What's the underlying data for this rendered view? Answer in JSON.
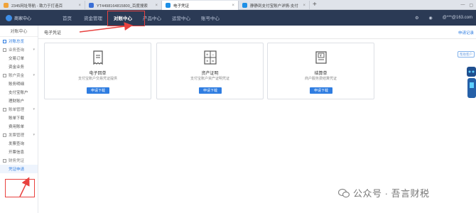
{
  "browser": {
    "tabs": [
      {
        "label": "2345网址导航 - 致力于打造百"
      },
      {
        "label": "YT4498164815800_百度搜索"
      },
      {
        "label": "电子凭证"
      },
      {
        "label": "静静到支付宝账户详情-支付"
      }
    ],
    "new_tab": "+"
  },
  "header": {
    "brand": "商家中心",
    "nav": [
      "首页",
      "资金管理",
      "对账中心",
      "产品中心",
      "运营中心",
      "账号中心"
    ],
    "user": "@***@163.com"
  },
  "sidebar": {
    "title": "对账中心",
    "overview": "对账总览",
    "groups": [
      {
        "label": "业务查询",
        "items": [
          "交易订单",
          "资金业务"
        ]
      },
      {
        "label": "账户资金",
        "items": [
          "账务明细",
          "支付宝账户",
          "理财账户"
        ]
      },
      {
        "label": "账单管理",
        "items": [
          "账单下载",
          "费用账单"
        ]
      },
      {
        "label": "发票管理",
        "items": [
          "发票查询",
          "开票信息"
        ]
      },
      {
        "label": "财务凭证",
        "items": [
          "凭证申请"
        ]
      }
    ]
  },
  "main": {
    "breadcrumb": "电子凭证",
    "right_link": "申请记录",
    "float_tag": "帮助客户",
    "cards": [
      {
        "title": "电子回单",
        "desc": "支付宝账户交易凭证提供",
        "button": "申请下载",
        "icon": "receipt-icon"
      },
      {
        "title": "资产证明",
        "desc": "支付宝账户资产证明凭证",
        "button": "申请下载",
        "icon": "calculator-icon"
      },
      {
        "title": "结算单",
        "desc": "商户服务费结算凭证",
        "button": "申请下载",
        "icon": "yen-document-icon"
      }
    ]
  },
  "watermark": "公众号 · 吾言财税",
  "colors": {
    "nav_bg": "#2b3a55",
    "accent": "#2f7de1",
    "annotation": "#e8423f"
  }
}
